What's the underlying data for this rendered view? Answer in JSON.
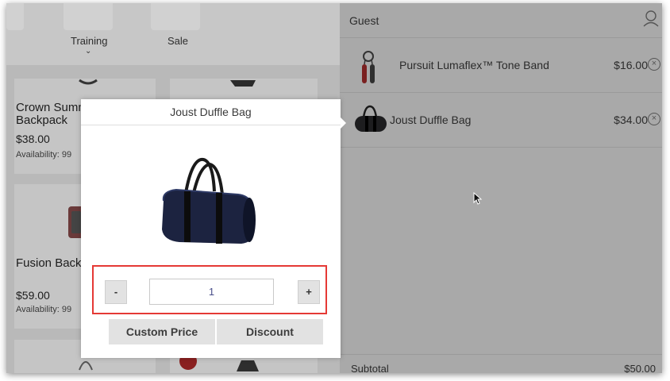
{
  "categories": [
    {
      "label": "Training",
      "has_chevron": true
    },
    {
      "label": "Sale",
      "has_chevron": false
    }
  ],
  "products": [
    {
      "name_line1": "Crown Summ",
      "name_line2": "Backpack",
      "price": "$38.00",
      "availability": "Availability: 99"
    },
    {
      "name_line1": "Fusion Back",
      "price": "$59.00",
      "availability": "Availability: 99"
    }
  ],
  "modal": {
    "title": "Joust Duffle Bag",
    "quantity": "1",
    "minus_label": "-",
    "plus_label": "+",
    "custom_price_label": "Custom Price",
    "discount_label": "Discount",
    "image_icon": "duffle-bag-image"
  },
  "cart": {
    "customer": "Guest",
    "items": [
      {
        "name": "Pursuit Lumaflex™ Tone Band",
        "price": "$16.00",
        "remove_icon": "close-circle-icon"
      },
      {
        "name": "Joust Duffle Bag",
        "price": "$34.00",
        "remove_icon": "close-circle-icon"
      }
    ],
    "subtotal_label": "Subtotal",
    "subtotal_value": "$50.00"
  },
  "colors": {
    "highlight": "#e53935",
    "qty_text": "#4a4f8a"
  }
}
